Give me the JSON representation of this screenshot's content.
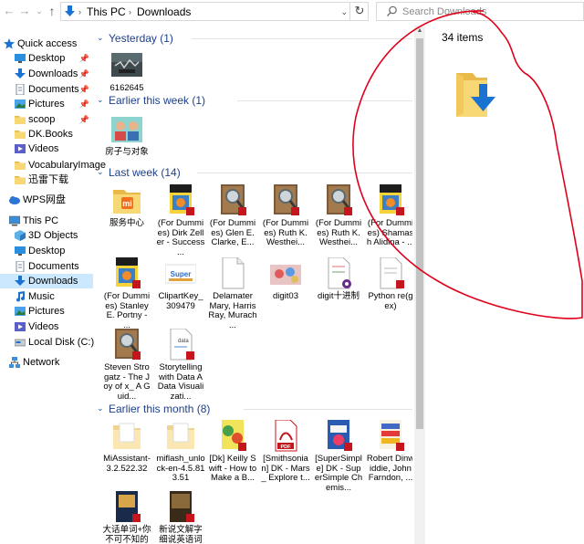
{
  "address_bar": {
    "crumbs": [
      "This PC",
      "Downloads"
    ],
    "search_placeholder": "Search Downloads"
  },
  "sidebar": {
    "items": [
      {
        "label": "Quick access",
        "icon": "star-icon",
        "pinned": false
      },
      {
        "label": "Desktop",
        "icon": "desktop-icon",
        "pinned": true
      },
      {
        "label": "Downloads",
        "icon": "downloads-icon",
        "pinned": true
      },
      {
        "label": "Documents",
        "icon": "documents-icon",
        "pinned": true
      },
      {
        "label": "Pictures",
        "icon": "pictures-icon",
        "pinned": true
      },
      {
        "label": "scoop",
        "icon": "folder-icon",
        "pinned": true
      },
      {
        "label": "DK.Books",
        "icon": "folder-icon",
        "pinned": false
      },
      {
        "label": "Videos",
        "icon": "videos-icon",
        "pinned": false
      },
      {
        "label": "VocabularyImage",
        "icon": "folder-icon",
        "pinned": false
      },
      {
        "label": "迅雷下载",
        "icon": "folder-icon",
        "pinned": false
      },
      {
        "label": "WPS网盘",
        "icon": "cloud-icon",
        "pinned": false
      },
      {
        "label": "This PC",
        "icon": "computer-icon",
        "pinned": false
      },
      {
        "label": "3D Objects",
        "icon": "cube-icon",
        "pinned": false
      },
      {
        "label": "Desktop",
        "icon": "desktop-icon",
        "pinned": false
      },
      {
        "label": "Documents",
        "icon": "documents-icon",
        "pinned": false
      },
      {
        "label": "Downloads",
        "icon": "downloads-icon",
        "pinned": false
      },
      {
        "label": "Music",
        "icon": "music-icon",
        "pinned": false
      },
      {
        "label": "Pictures",
        "icon": "pictures-icon",
        "pinned": false
      },
      {
        "label": "Videos",
        "icon": "videos-icon",
        "pinned": false
      },
      {
        "label": "Local Disk (C:)",
        "icon": "disk-icon",
        "pinned": false
      },
      {
        "label": "Network",
        "icon": "network-icon",
        "pinned": false
      }
    ]
  },
  "groups": [
    {
      "title": "Yesterday (1)",
      "files": [
        {
          "name": "6162645",
          "type": "image-dark"
        }
      ]
    },
    {
      "title": "Earlier this week (1)",
      "files": [
        {
          "name": "房子与对象",
          "type": "image-teal"
        }
      ]
    },
    {
      "title": "Last week (14)",
      "files": [
        {
          "name": "服务中心",
          "type": "folder-mi"
        },
        {
          "name": "(For Dummies) Dirk Zeller - Success ...",
          "type": "book-pdf"
        },
        {
          "name": "(For Dummies) Glen E. Clarke, E...",
          "type": "doc-magnifier"
        },
        {
          "name": "(For Dummies) Ruth K. Westhei...",
          "type": "doc-magnifier"
        },
        {
          "name": "(For Dummies) Ruth K. Westhei...",
          "type": "doc-magnifier"
        },
        {
          "name": "(For Dummies) Shamash Alidina - ...",
          "type": "book-pdf"
        },
        {
          "name": "(For Dummies) Stanley E. Portny - ...",
          "type": "book-pdf"
        },
        {
          "name": "ClipartKey_309479",
          "type": "image-clipart"
        },
        {
          "name": "Delamater Mary, Harris Ray, Murach ...",
          "type": "blank-doc"
        },
        {
          "name": "digit03",
          "type": "image-digit"
        },
        {
          "name": "digit十进制",
          "type": "doc-digit"
        },
        {
          "name": "Python re(gex)",
          "type": "doc-python"
        },
        {
          "name": "Steven Strogatz - The Joy of x_ A Guid...",
          "type": "doc-magnifier"
        },
        {
          "name": "Storytelling with Data A Data Visualizati...",
          "type": "doc-story"
        }
      ]
    },
    {
      "title": "Earlier this month (8)",
      "files": [
        {
          "name": "MiAssistant-3.2.522.32",
          "type": "folder-light"
        },
        {
          "name": "miflash_unlock-en-4.5.813.51",
          "type": "folder-light"
        },
        {
          "name": "[Dk] Keilly Swift - How to Make a B...",
          "type": "book-pdf-yellow"
        },
        {
          "name": "[Smithsonian] DK - Mars_ Explore t...",
          "type": "pdf-red"
        },
        {
          "name": "[SuperSimple] DK - SuperSimple Chemis...",
          "type": "book-pdf-blue"
        },
        {
          "name": "Robert Dinwiddie, John Farndon, ...",
          "type": "book-pdf-sci"
        },
        {
          "name": "大话单词+你不可不知的词源",
          "type": "book-old"
        },
        {
          "name": "新说文解字 细说英语词根",
          "type": "book-old2"
        }
      ]
    }
  ],
  "details": {
    "count": "34 items"
  },
  "colors": {
    "group_title": "#1e3f8a",
    "selection": "#cce8ff",
    "annotation": "#e0001a",
    "folder": "#f8d775"
  }
}
